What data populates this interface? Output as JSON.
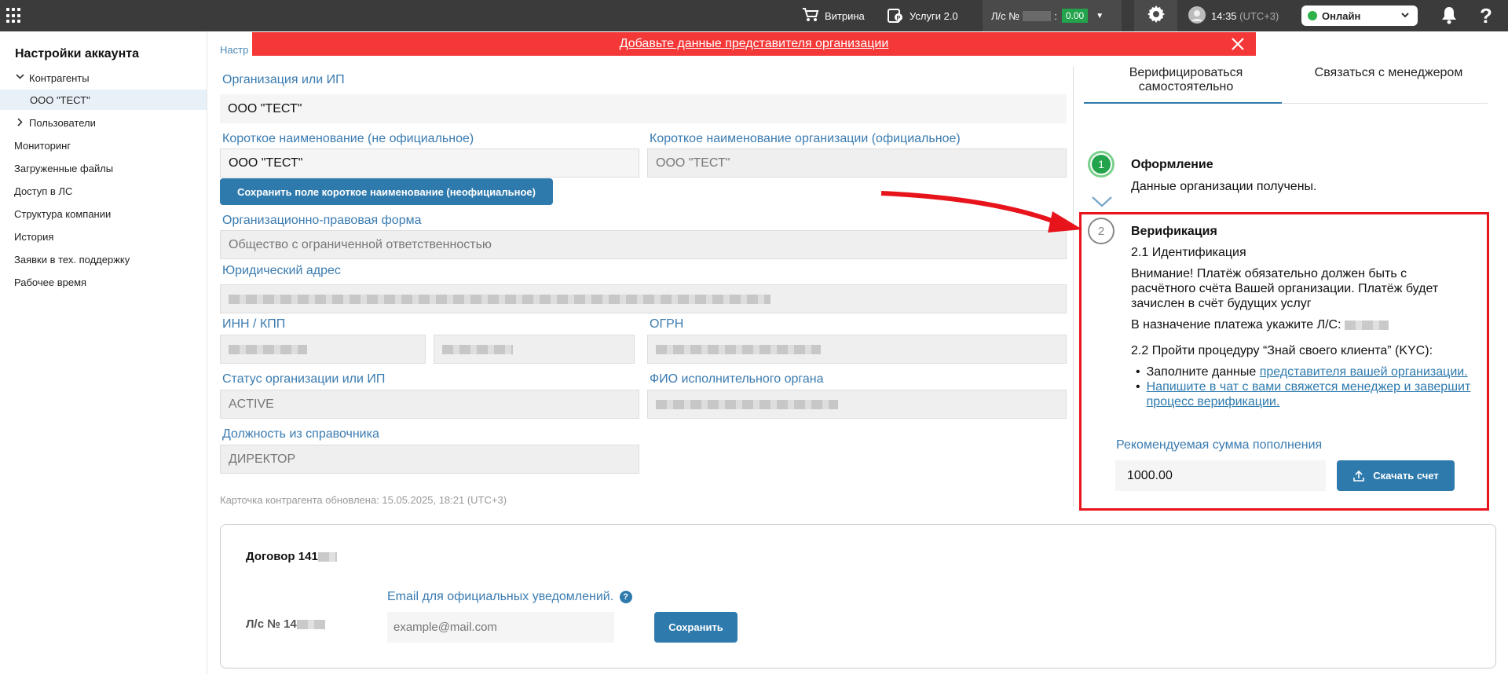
{
  "topbar": {
    "vitrina": "Витрина",
    "services": "Услуги 2.0",
    "account_label": "Л/с №",
    "balance": "0.00",
    "time": "14:35",
    "timezone": "(UTC+3)",
    "status": "Онлайн",
    "help": "?"
  },
  "sidebar": {
    "title": "Настройки аккаунта",
    "counterparties": "Контрагенты",
    "org_item": "ООО \"ТЕСТ\"",
    "users": "Пользователи",
    "items": [
      "Мониторинг",
      "Загруженные файлы",
      "Доступ в ЛС",
      "Структура компании",
      "История",
      "Заявки в тех. поддержку",
      "Рабочее время"
    ]
  },
  "alert": {
    "text": "Добавьте данные представителя организации"
  },
  "breadcrumb": "Настр",
  "form": {
    "org_label": "Организация или ИП",
    "org_value": "ООО \"ТЕСТ\"",
    "short_name_label": "Короткое наименование (не официальное)",
    "short_name_value": "ООО \"ТЕСТ\"",
    "official_short_label": "Короткое наименование организации (официальное)",
    "official_short_value": "ООО \"ТЕСТ\"",
    "save_short_button": "Сохранить поле короткое наименование (неофициальное)",
    "legal_form_label": "Организационно-правовая форма",
    "legal_form_value": "Общество с ограниченной ответственностью",
    "address_label": "Юридический адрес",
    "inn_label": "ИНН / КПП",
    "ogrn_label": "ОГРН",
    "status_label": "Статус организации или ИП",
    "status_value": "ACTIVE",
    "head_label": "ФИО исполнительного органа",
    "position_label": "Должность из справочника",
    "position_value": "ДИРЕКТОР",
    "updated": "Карточка контрагента обновлена: 15.05.2025, 18:21 (UTC+3)"
  },
  "verify": {
    "tab_self": "Верифицироваться самостоятельно",
    "tab_manager": "Связаться с менеджером",
    "step1_num": "1",
    "step1_title": "Оформление",
    "step1_text": "Данные организации получены.",
    "step2_num": "2",
    "step2_title": "Верификация",
    "step2_sub1": "2.1 Идентификация",
    "step2_warning": "Внимание! Платёж обязательно должен быть с расчётного счёта Вашей организации. Платёж будет зачислен в счёт будущих услуг",
    "step2_purpose": "В назначение платежа укажите Л/С:",
    "step2_sub2": "2.2 Пройти процедуру “Знай своего клиента” (KYC):",
    "bullet1_text": "Заполните данные ",
    "bullet1_link": "представителя вашей организации.",
    "bullet2_link": "Напишите в чат с вами свяжется менеджер и завершит процесс верификации.",
    "amount_label": "Рекомендуемая сумма пополнения",
    "amount_value": "1000.00",
    "invoice_button": "Скачать счет"
  },
  "contract": {
    "title": "Договор 141",
    "account": "Л/с № 14",
    "email_label": "Email для официальных уведомлений.",
    "email_placeholder": "example@mail.com",
    "save_button": "Сохранить"
  },
  "colors": {
    "topbar": "#3b3b3b",
    "accent": "#2e7aad",
    "alert": "#f43737",
    "success": "#23a34b",
    "highlight": "#e8141c"
  }
}
